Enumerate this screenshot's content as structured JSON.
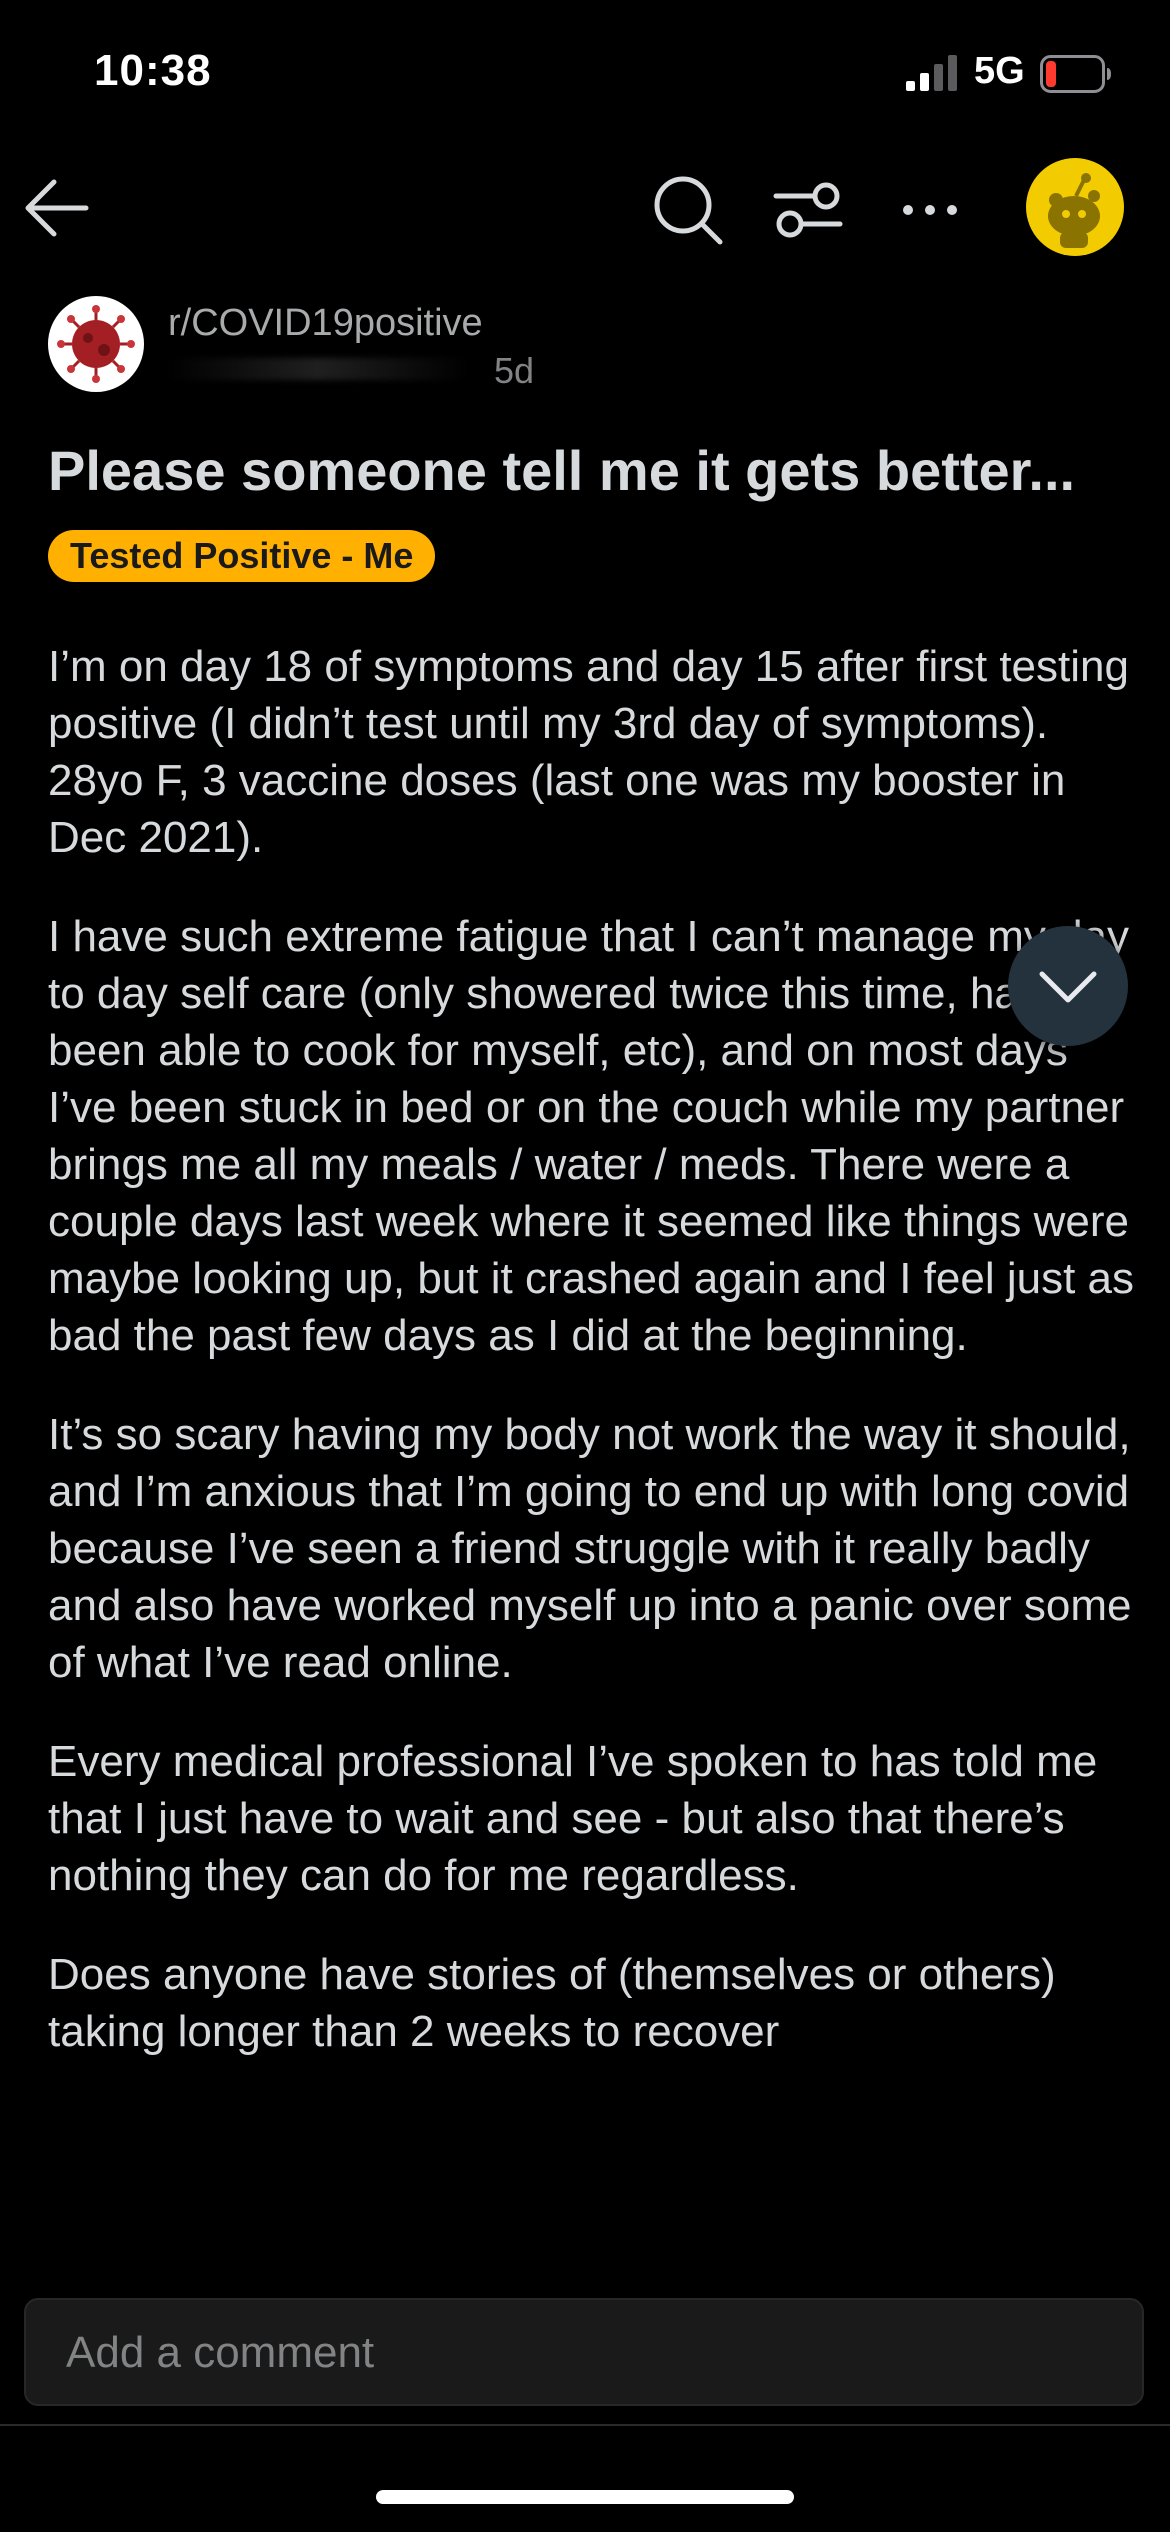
{
  "status_bar": {
    "time": "10:38",
    "network": "5G",
    "battery_level": "low",
    "battery_color": "#ff3b30"
  },
  "nav": {
    "icons": [
      "back-arrow-icon",
      "search-icon",
      "filter-icon",
      "more-icon",
      "user-avatar-icon"
    ],
    "avatar_color": "#f2cc00"
  },
  "post": {
    "community": "r/COVID19positive",
    "age": "5d",
    "title": "Please someone tell me it gets better...",
    "flair": "Tested Positive - Me",
    "flair_color": "#ffb000",
    "paragraphs": [
      "I’m on day 18 of symptoms and day 15 after first testing positive (I didn’t test until my 3rd day of symptoms). 28yo F, 3 vaccine doses (last one was my booster in Dec 2021).",
      "I have such extreme fatigue that I can’t manage my day to day self care (only showered twice this time, haven’t been able to cook for myself, etc), and on most days I’ve been stuck in bed or on the couch while my partner brings me all my meals / water / meds. There were a couple days last week where it seemed like things were maybe looking up, but it crashed again and I feel just as bad the past few days as I did at the beginning.",
      "It’s so scary having my body not work the way it should, and I’m anxious that I’m going to end up with long covid because I’ve seen a friend struggle with it really badly and also have worked myself up into a panic over some of what I’ve read online.",
      "Every medical professional I’ve spoken to has told me that I just have to wait and see - but also that there’s nothing they can do for me regardless.",
      "Does anyone have stories of (themselves or others) taking longer than 2 weeks to recover"
    ]
  },
  "comment": {
    "placeholder": "Add a comment"
  }
}
